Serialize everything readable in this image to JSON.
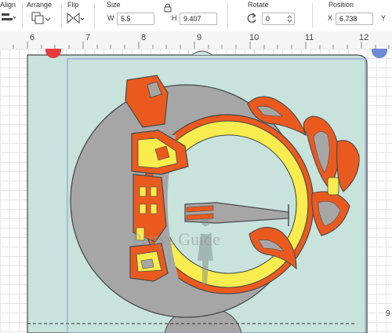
{
  "toolbar": {
    "align_label": "Align",
    "arrange_label": "Arrange",
    "flip_label": "Flip",
    "size_label": "Size",
    "width_key": "W",
    "width_value": "5.5",
    "height_key": "H",
    "height_value": "9.407",
    "rotate_label": "Rotate",
    "rotate_value": "0",
    "position_label": "Position",
    "x_key": "X",
    "x_value": "6.738",
    "y_key": "Y"
  },
  "ruler": {
    "marks": [
      "6",
      "7",
      "8",
      "9",
      "10",
      "11",
      "12"
    ],
    "side_mark": "9"
  },
  "watermark": "Pattys Guide",
  "colors": {
    "card": "#c8e2dc",
    "gray": "#a6a6a6",
    "orange": "#ea5a1f",
    "yellow": "#f8ec4e",
    "selection": "#8fa4d4",
    "handle_red": "#e53b3b",
    "handle_blue": "#6c8ad6"
  }
}
